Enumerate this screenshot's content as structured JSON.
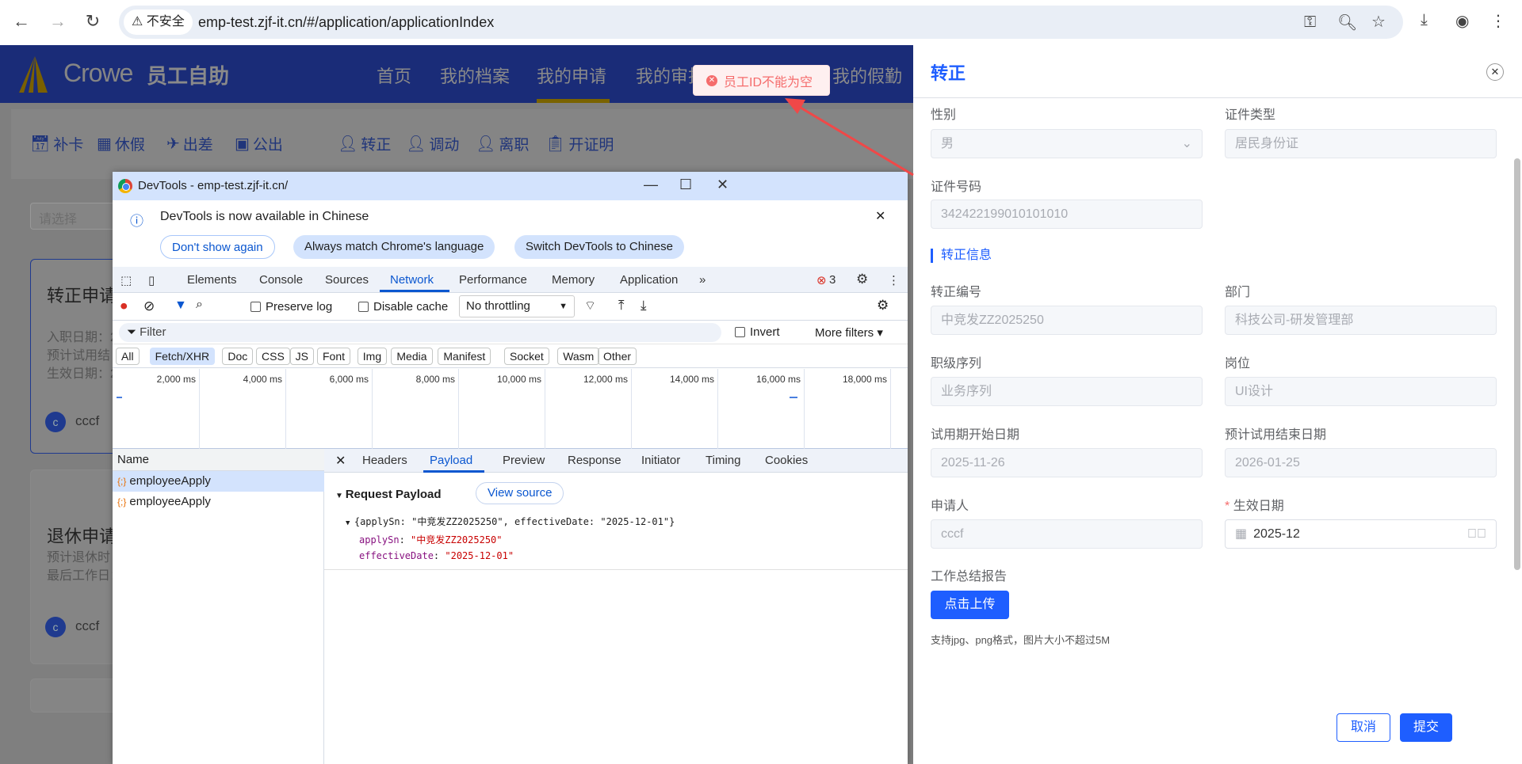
{
  "browser": {
    "security_label": "不安全",
    "url": "emp-test.zjf-it.cn/#/application/applicationIndex"
  },
  "app": {
    "logo_text": "Crowe",
    "logo_cn": "员工自助",
    "nav": [
      "首页",
      "我的档案",
      "我的申请",
      "我的审批",
      "我的假勤"
    ],
    "quick_actions": [
      {
        "icon": "calendar-check-icon",
        "label": "补卡"
      },
      {
        "icon": "calendar-icon",
        "label": "休假"
      },
      {
        "icon": "plane-icon",
        "label": "出差"
      },
      {
        "icon": "briefcase-icon",
        "label": "公出"
      },
      {
        "icon": "user-check-icon",
        "label": "转正"
      },
      {
        "icon": "user-transfer-icon",
        "label": "调动"
      },
      {
        "icon": "user-leave-icon",
        "label": "离职"
      },
      {
        "icon": "clipboard-icon",
        "label": "开证明"
      }
    ],
    "select_placeholder": "请选择",
    "cards": [
      {
        "title": "转正申请",
        "lines": [
          "入职日期：2",
          "预计试用结",
          "生效日期：2"
        ],
        "avatar": "c",
        "user": "cccf"
      },
      {
        "title": "退休申请",
        "lines": [
          "预计退休时",
          "最后工作日："
        ],
        "avatar": "c",
        "user": "cccf"
      }
    ]
  },
  "toast": {
    "message": "员工ID不能为空",
    "color": "#f56c6c"
  },
  "devtools": {
    "title": "DevTools - emp-test.zjf-it.cn/",
    "info": "DevTools is now available in Chinese",
    "info_buttons": [
      "Don't show again",
      "Always match Chrome's language",
      "Switch DevTools to Chinese"
    ],
    "tabs": [
      "Elements",
      "Console",
      "Sources",
      "Network",
      "Performance",
      "Memory",
      "Application"
    ],
    "active_tab": "Network",
    "error_count": "3",
    "preserve_log": "Preserve log",
    "disable_cache": "Disable cache",
    "throttling": "No throttling",
    "filter_placeholder": "Filter",
    "invert": "Invert",
    "more_filters": "More filters",
    "chips": [
      "All",
      "Fetch/XHR",
      "Doc",
      "CSS",
      "JS",
      "Font",
      "Img",
      "Media",
      "Manifest",
      "Socket",
      "Wasm",
      "Other"
    ],
    "timeline_ticks": [
      "2,000 ms",
      "4,000 ms",
      "6,000 ms",
      "8,000 ms",
      "10,000 ms",
      "12,000 ms",
      "14,000 ms",
      "16,000 ms",
      "18,000 ms"
    ],
    "name_header": "Name",
    "requests": [
      "employeeApply",
      "employeeApply"
    ],
    "detail_tabs": [
      "Headers",
      "Payload",
      "Preview",
      "Response",
      "Initiator",
      "Timing",
      "Cookies"
    ],
    "payload": {
      "heading": "Request Payload",
      "view_source": "View source",
      "summary": "{applySn: \"中竞发ZZ2025250\", effectiveDate: \"2025-12-01\"}",
      "fields": [
        {
          "key": "applySn",
          "value": "\"中竞发ZZ2025250\""
        },
        {
          "key": "effectiveDate",
          "value": "\"2025-12-01\""
        }
      ]
    }
  },
  "drawer": {
    "title": "转正",
    "section": "转正信息",
    "fields": {
      "gender": {
        "label": "性别",
        "value": "男"
      },
      "id_type": {
        "label": "证件类型",
        "value": "居民身份证"
      },
      "id_no": {
        "label": "证件号码",
        "value": "342422199010101010"
      },
      "sn": {
        "label": "转正编号",
        "value": "中竞发ZZ2025250"
      },
      "dept": {
        "label": "部门",
        "value": "科技公司-研发管理部"
      },
      "rank": {
        "label": "职级序列",
        "value": "业务序列"
      },
      "post": {
        "label": "岗位",
        "value": "UI设计"
      },
      "start": {
        "label": "试用期开始日期",
        "value": "2025-11-26"
      },
      "end": {
        "label": "预计试用结束日期",
        "value": "2026-01-25"
      },
      "applicant": {
        "label": "申请人",
        "value": "cccf"
      },
      "effective": {
        "label": "生效日期",
        "value": "2025-12",
        "required": "*"
      }
    },
    "report_label": "工作总结报告",
    "upload": "点击上传",
    "hint": "支持jpg、png格式，图片大小不超过5M",
    "cancel": "取消",
    "submit": "提交",
    "accent": "#1e5eff"
  }
}
